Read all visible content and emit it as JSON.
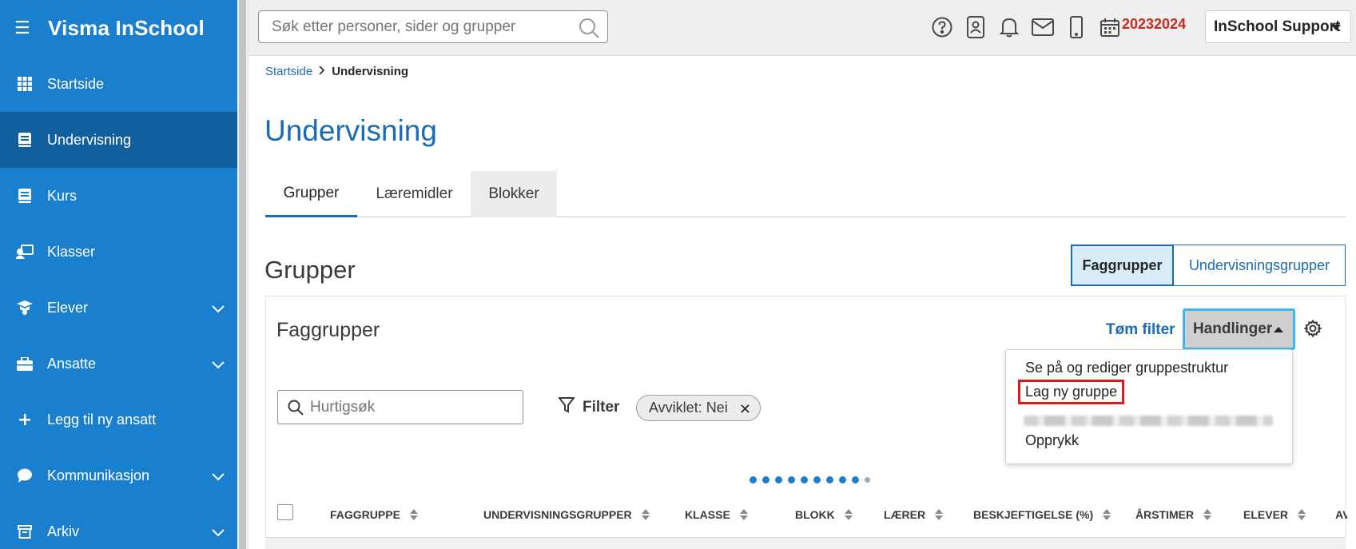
{
  "app": {
    "title": "Visma InSchool"
  },
  "sidebar": {
    "items": [
      {
        "label": "Startside",
        "icon": "grid-icon",
        "active": false,
        "expandable": false
      },
      {
        "label": "Undervisning",
        "icon": "book-icon",
        "active": true,
        "expandable": false
      },
      {
        "label": "Kurs",
        "icon": "book-icon",
        "active": false,
        "expandable": false
      },
      {
        "label": "Klasser",
        "icon": "classroom-icon",
        "active": false,
        "expandable": false
      },
      {
        "label": "Elever",
        "icon": "graduation-cap-icon",
        "active": false,
        "expandable": true
      },
      {
        "label": "Ansatte",
        "icon": "briefcase-icon",
        "active": false,
        "expandable": true
      },
      {
        "label": "Legg til ny ansatt",
        "icon": "plus-icon",
        "active": false,
        "expandable": false
      },
      {
        "label": "Kommunikasjon",
        "icon": "chat-bubble-icon",
        "active": false,
        "expandable": true
      },
      {
        "label": "Arkiv",
        "icon": "archive-icon",
        "active": false,
        "expandable": true
      }
    ]
  },
  "topbar": {
    "search_placeholder": "Søk etter personer, sider og grupper",
    "school_year": "20232024",
    "user_label": "InSchool Support",
    "icons": [
      "help-icon",
      "contacts-icon",
      "bell-icon",
      "mail-icon",
      "mobile-icon",
      "calendar-icon"
    ]
  },
  "breadcrumb": {
    "home": "Startside",
    "current": "Undervisning"
  },
  "page": {
    "title": "Undervisning"
  },
  "tabs": [
    {
      "label": "Grupper",
      "active": true
    },
    {
      "label": "Læremidler",
      "active": false
    },
    {
      "label": "Blokker",
      "active": false
    }
  ],
  "section": {
    "title": "Grupper",
    "toggle": [
      "Faggrupper",
      "Undervisningsgrupper"
    ],
    "toggle_selected": "Faggrupper"
  },
  "card": {
    "title": "Faggrupper",
    "clear_filter": "Tøm filter",
    "actions_label": "Handlinger",
    "quick_search_placeholder": "Hurtigsøk",
    "filter_label": "Filter",
    "chip_label": "Avviklet: Nei"
  },
  "actions_menu": {
    "items": [
      "Se på og rediger gruppestruktur",
      "Lag ny gruppe",
      "Opprykk"
    ],
    "highlighted": "Lag ny gruppe"
  },
  "table": {
    "columns": [
      "FAGGRUPPE",
      "UNDERVISNINGSGRUPPER",
      "KLASSE",
      "BLOKK",
      "LÆRER",
      "BESKJEFTIGELSE (%)",
      "ÅRSTIMER",
      "ELEVER",
      "AV"
    ]
  },
  "colors": {
    "sidebar": "#1a7fcc",
    "sidebar_active": "#115f9c",
    "link": "#1a6bb3",
    "year": "#d0271d",
    "highlight_outline": "#e0191c"
  }
}
